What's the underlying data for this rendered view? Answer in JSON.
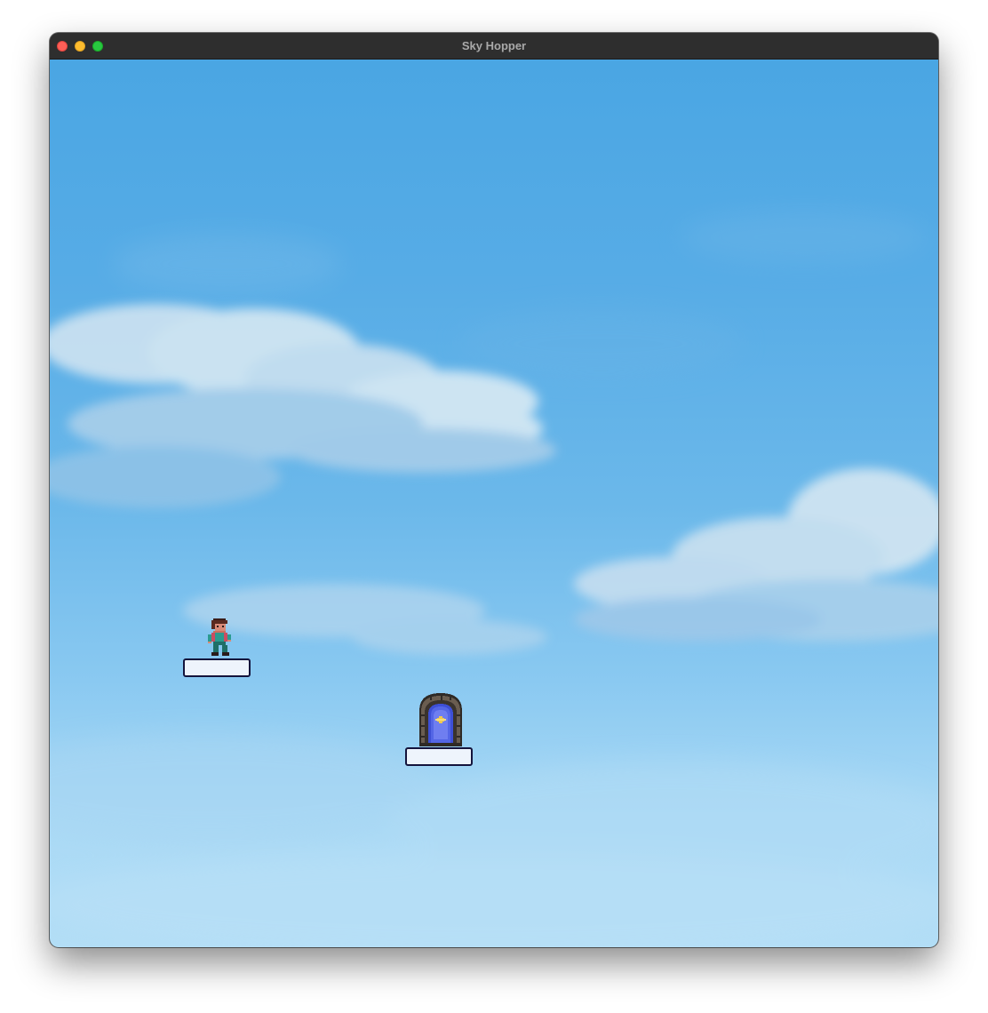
{
  "window": {
    "title": "Sky Hopper",
    "buttons": {
      "close": "close-button",
      "minimize": "minimize-button",
      "maximize": "maximize-button"
    }
  },
  "scene": {
    "sky_colors": {
      "top": "#4aa6e3",
      "bottom": "#b3def6",
      "cloud": "#dbeaf4"
    },
    "player": {
      "icon": "player-character-icon",
      "hair": "#5a2a20",
      "skin": "#c9705f",
      "shirt": "#2a9b8f"
    },
    "portal": {
      "icon": "portal-icon",
      "frame": "#5d5145",
      "core": "#5466e6",
      "star": "#f2c94c"
    },
    "platforms": [
      {
        "id": "platform-1"
      },
      {
        "id": "platform-2"
      }
    ]
  }
}
